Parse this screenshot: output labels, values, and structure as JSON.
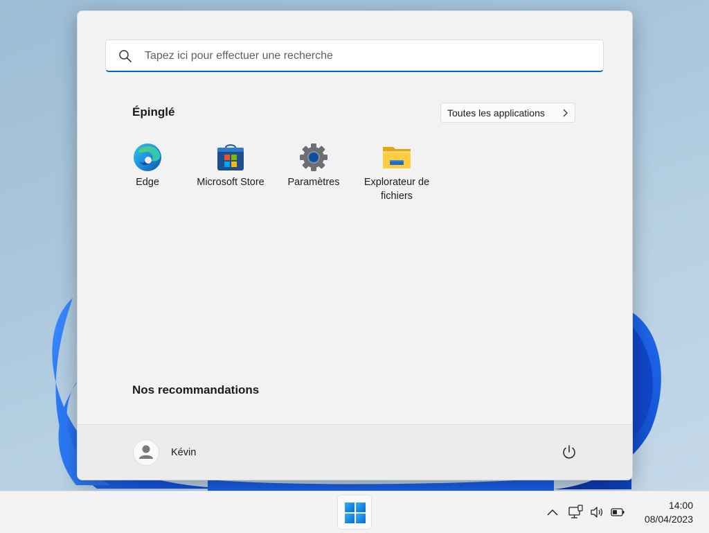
{
  "search": {
    "placeholder": "Tapez ici pour effectuer une recherche"
  },
  "pinned": {
    "title": "Épinglé",
    "all_apps_label": "Toutes les applications",
    "apps": [
      {
        "label": "Edge",
        "icon": "edge-icon"
      },
      {
        "label": "Microsoft Store",
        "icon": "microsoft-store-icon"
      },
      {
        "label": "Paramètres",
        "icon": "settings-gear-icon"
      },
      {
        "label": "Explorateur de fichiers",
        "icon": "file-explorer-folder-icon"
      }
    ]
  },
  "recommendations": {
    "title": "Nos recommandations"
  },
  "user": {
    "name": "Kévin"
  },
  "taskbar": {
    "time": "14:00",
    "date": "08/04/2023",
    "tray_icons": [
      "chevron-up-icon",
      "network-icon",
      "volume-icon",
      "battery-icon"
    ]
  },
  "colors": {
    "accent": "#0067c0",
    "menu_bg": "#f2f2f2",
    "taskbar_bg": "#f3f3f3"
  }
}
